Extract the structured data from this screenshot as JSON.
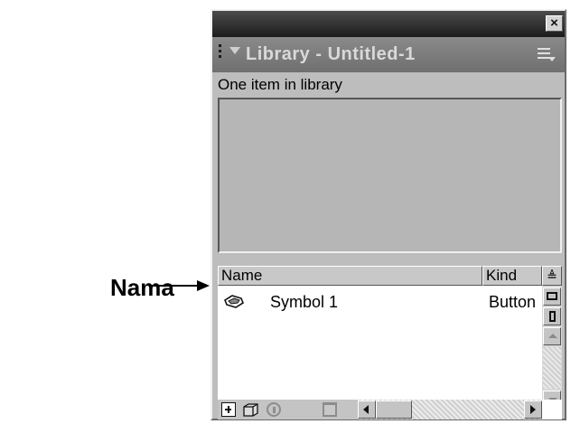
{
  "window": {
    "close_glyph": "×"
  },
  "panel": {
    "title": "Library - Untitled-1",
    "status": "One item in library"
  },
  "columns": {
    "name": "Name",
    "kind": "Kind",
    "sort_glyph": "≜"
  },
  "items": [
    {
      "name": "Symbol 1",
      "kind": "Button",
      "icon": "button-symbol-icon"
    }
  ],
  "callout": {
    "label": "Nama"
  },
  "colors": {
    "titlebar": "#2a2a2a",
    "header": "#7a7a7a",
    "panel_bg": "#bdbdbd",
    "preview_bg": "#b6b6b6",
    "list_bg": "#ffffff"
  }
}
